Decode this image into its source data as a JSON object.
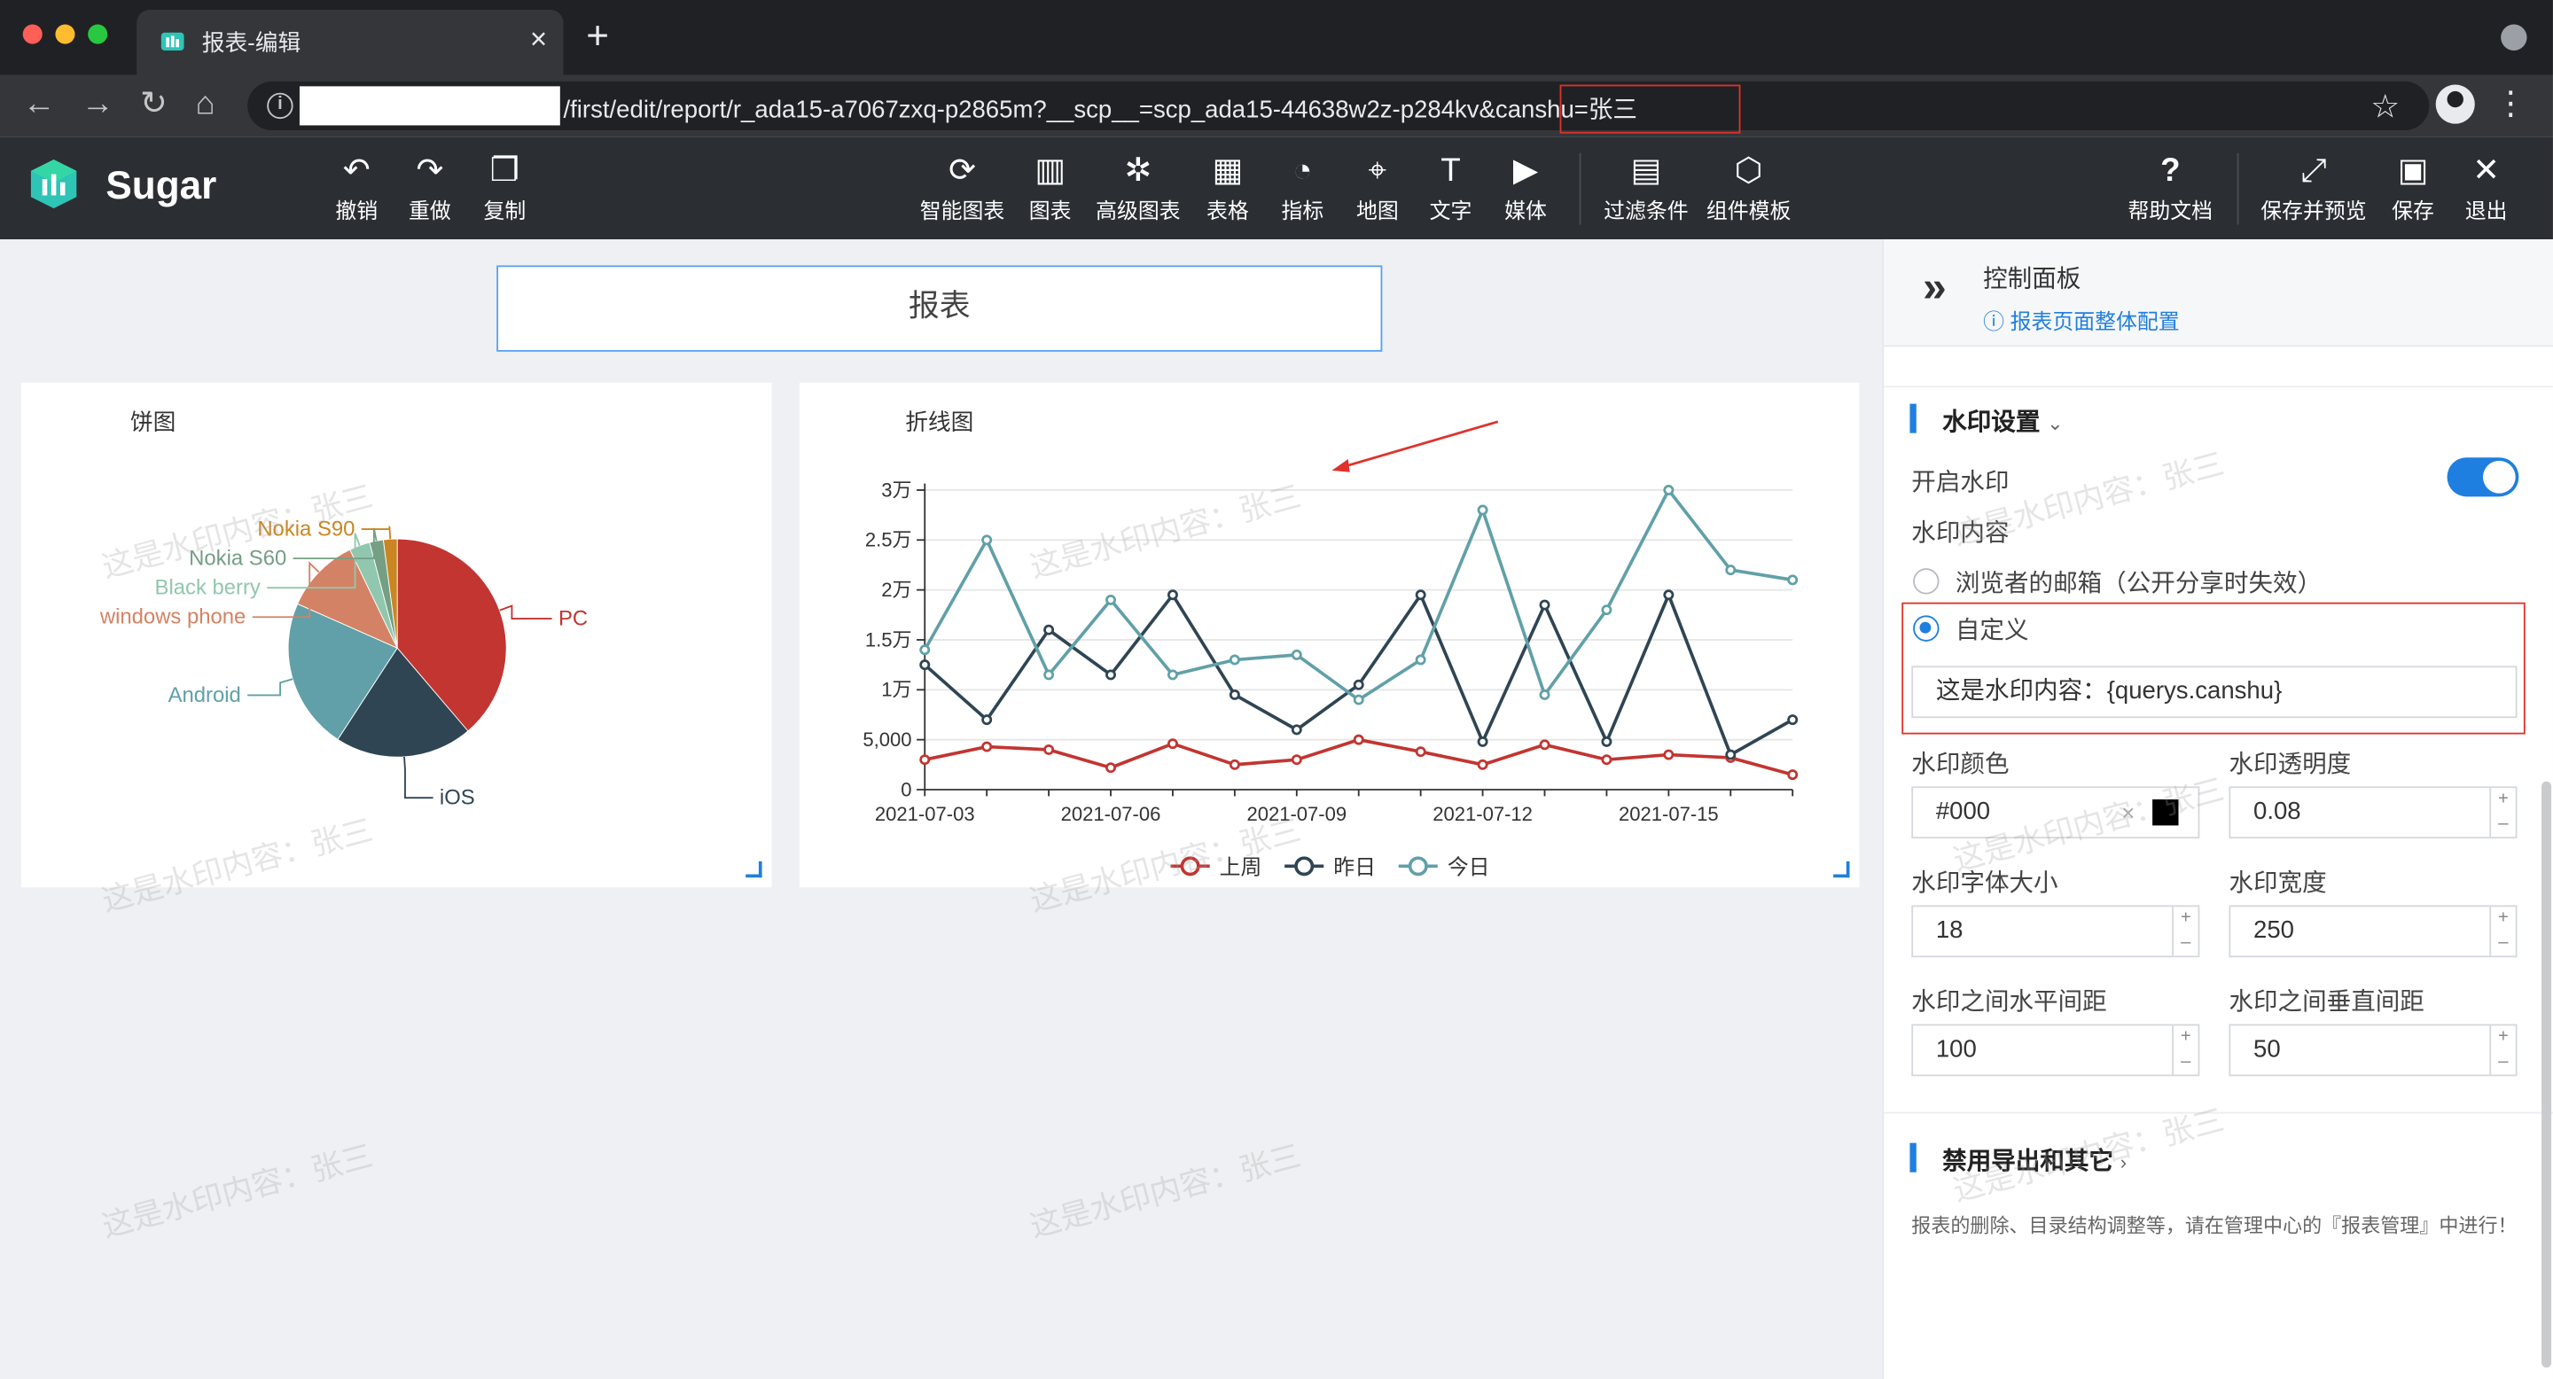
{
  "browser": {
    "tab_title": "报表-编辑",
    "url_text": "/first/edit/report/r_ada15-a7067zxq-p2865m?__scp__=scp_ada15-44638w2z-p284kv&canshu=张三"
  },
  "toolbar": {
    "brand": "Sugar",
    "undo": "撤销",
    "redo": "重做",
    "copy": "复制",
    "smart_chart": "智能图表",
    "chart": "图表",
    "advanced_chart": "高级图表",
    "table": "表格",
    "metric": "指标",
    "map": "地图",
    "text": "文字",
    "media": "媒体",
    "filter": "过滤条件",
    "component_template": "组件模板",
    "help": "帮助文档",
    "save_preview": "保存并预览",
    "save": "保存",
    "exit": "退出"
  },
  "canvas": {
    "report_title": "报表",
    "watermark_text": "这是水印内容：张三"
  },
  "pie_card": {
    "title": "饼图",
    "chart_data": {
      "type": "pie",
      "categories": [
        "PC",
        "iOS",
        "Android",
        "windows phone",
        "Black berry",
        "Nokia S60",
        "Nokia S90"
      ],
      "values": [
        38,
        20,
        22,
        11,
        3,
        2,
        2
      ],
      "colors": [
        "#c23531",
        "#2f4554",
        "#61a0a8",
        "#d48265",
        "#91c7ae",
        "#749f83",
        "#ca8622"
      ]
    }
  },
  "line_card": {
    "title": "折线图",
    "chart_data": {
      "type": "line",
      "x": [
        "2021-07-03",
        "2021-07-04",
        "2021-07-05",
        "2021-07-06",
        "2021-07-07",
        "2021-07-08",
        "2021-07-09",
        "2021-07-10",
        "2021-07-11",
        "2021-07-12",
        "2021-07-13",
        "2021-07-14",
        "2021-07-15",
        "2021-07-16",
        "2021-07-17"
      ],
      "x_tick_labels": [
        "2021-07-03",
        "2021-07-06",
        "2021-07-09",
        "2021-07-12",
        "2021-07-15"
      ],
      "y_tick_labels": [
        "0",
        "5,000",
        "1万",
        "1.5万",
        "2万",
        "2.5万",
        "3万"
      ],
      "ylim": [
        0,
        30000
      ],
      "series": [
        {
          "name": "上周",
          "color": "#c23531",
          "values": [
            3000,
            4300,
            4000,
            2200,
            4600,
            2500,
            3000,
            5000,
            3800,
            2500,
            4500,
            3000,
            3500,
            3200,
            1500
          ]
        },
        {
          "name": "昨日",
          "color": "#2f4554",
          "values": [
            12500,
            7000,
            16000,
            11500,
            19500,
            9500,
            6000,
            10500,
            19500,
            4800,
            18500,
            4800,
            19500,
            3500,
            7000
          ]
        },
        {
          "name": "今日",
          "color": "#61a0a8",
          "values": [
            14000,
            25000,
            11500,
            19000,
            11500,
            13000,
            13500,
            9000,
            13000,
            28000,
            9500,
            18000,
            30000,
            22000,
            21000
          ]
        }
      ]
    }
  },
  "panel": {
    "title": "控制面板",
    "subtitle": "报表页面整体配置",
    "watermark_section": "水印设置",
    "enable_label": "开启水印",
    "content_label": "水印内容",
    "option_email": "浏览者的邮箱（公开分享时失效）",
    "option_custom": "自定义",
    "custom_value": "这是水印内容：{querys.canshu}",
    "color_label": "水印颜色",
    "color_value": "#000",
    "opacity_label": "水印透明度",
    "opacity_value": "0.08",
    "fontsize_label": "水印字体大小",
    "fontsize_value": "18",
    "width_label": "水印宽度",
    "width_value": "250",
    "hgap_label": "水印之间水平间距",
    "hgap_value": "100",
    "vgap_label": "水印之间垂直间距",
    "vgap_value": "50",
    "disable_section": "禁用导出和其它",
    "note": "报表的删除、目录结构调整等，请在管理中心的『报表管理』中进行！"
  }
}
